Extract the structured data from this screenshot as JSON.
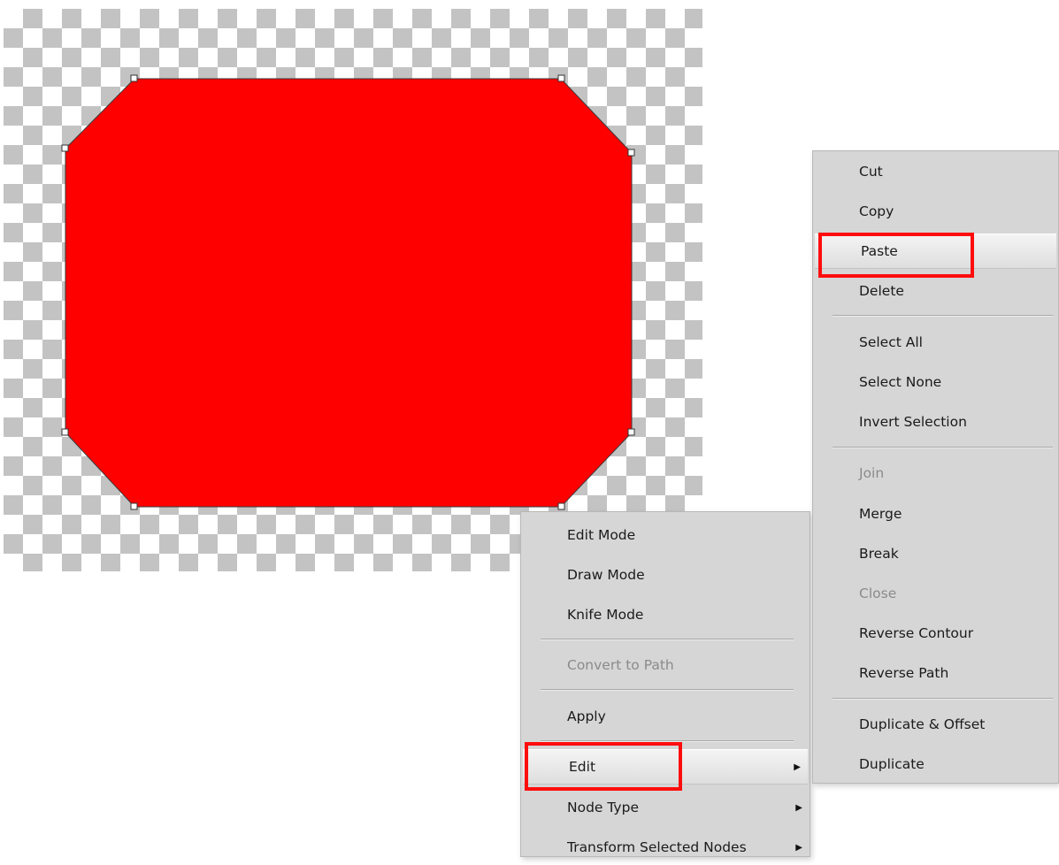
{
  "canvas": {
    "fill_color": "#ff0000",
    "checker_color": "#c3c3c3"
  },
  "context_menu": {
    "items": [
      {
        "label": "Edit Mode",
        "enabled": true
      },
      {
        "label": "Draw Mode",
        "enabled": true
      },
      {
        "label": "Knife Mode",
        "enabled": true
      },
      {
        "label": "Convert to Path",
        "enabled": false
      },
      {
        "label": "Apply",
        "enabled": true
      },
      {
        "label": "Edit",
        "enabled": true,
        "submenu": true,
        "highlighted": true
      },
      {
        "label": "Node Type",
        "enabled": true,
        "submenu": true
      },
      {
        "label": "Transform Selected Nodes",
        "enabled": true,
        "submenu": true
      }
    ],
    "arrow_glyph": "▶"
  },
  "edit_submenu": {
    "items": [
      {
        "label": "Cut",
        "enabled": true
      },
      {
        "label": "Copy",
        "enabled": true
      },
      {
        "label": "Paste",
        "enabled": true,
        "highlighted": true
      },
      {
        "label": "Delete",
        "enabled": true
      },
      {
        "label": "Select All",
        "enabled": true
      },
      {
        "label": "Select None",
        "enabled": true
      },
      {
        "label": "Invert Selection",
        "enabled": true
      },
      {
        "label": "Join",
        "enabled": false
      },
      {
        "label": "Merge",
        "enabled": true
      },
      {
        "label": "Break",
        "enabled": true
      },
      {
        "label": "Close",
        "enabled": false
      },
      {
        "label": "Reverse Contour",
        "enabled": true
      },
      {
        "label": "Reverse Path",
        "enabled": true
      },
      {
        "label": "Duplicate & Offset",
        "enabled": true
      },
      {
        "label": "Duplicate",
        "enabled": true
      }
    ]
  },
  "annotation": {
    "highlight_color": "#ff0d0d"
  }
}
